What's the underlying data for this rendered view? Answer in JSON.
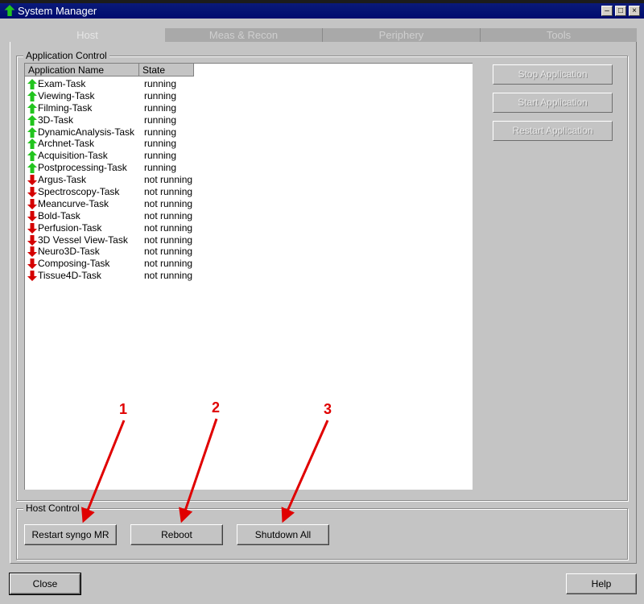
{
  "window": {
    "title": "System Manager"
  },
  "tabs": [
    "Host",
    "Meas & Recon",
    "Periphery",
    "Tools"
  ],
  "application_control": {
    "label": "Application Control",
    "columns": [
      "Application Name",
      "State"
    ],
    "rows": [
      {
        "name": "Exam-Task",
        "state": "running",
        "status": "up"
      },
      {
        "name": "Viewing-Task",
        "state": "running",
        "status": "up"
      },
      {
        "name": "Filming-Task",
        "state": "running",
        "status": "up"
      },
      {
        "name": "3D-Task",
        "state": "running",
        "status": "up"
      },
      {
        "name": "DynamicAnalysis-Task",
        "state": "running",
        "status": "up"
      },
      {
        "name": "Archnet-Task",
        "state": "running",
        "status": "up"
      },
      {
        "name": "Acquisition-Task",
        "state": "running",
        "status": "up"
      },
      {
        "name": "Postprocessing-Task",
        "state": "running",
        "status": "up"
      },
      {
        "name": "Argus-Task",
        "state": "not running",
        "status": "down"
      },
      {
        "name": "Spectroscopy-Task",
        "state": "not running",
        "status": "down"
      },
      {
        "name": "Meancurve-Task",
        "state": "not running",
        "status": "down"
      },
      {
        "name": "Bold-Task",
        "state": "not running",
        "status": "down"
      },
      {
        "name": "Perfusion-Task",
        "state": "not running",
        "status": "down"
      },
      {
        "name": "3D Vessel View-Task",
        "state": "not running",
        "status": "down"
      },
      {
        "name": "Neuro3D-Task",
        "state": "not running",
        "status": "down"
      },
      {
        "name": "Composing-Task",
        "state": "not running",
        "status": "down"
      },
      {
        "name": "Tissue4D-Task",
        "state": "not running",
        "status": "down"
      }
    ],
    "buttons": {
      "stop": "Stop Application",
      "start": "Start Application",
      "restart": "Restart Application"
    }
  },
  "host_control": {
    "label": "Host Control",
    "buttons": {
      "restart_syngo": "Restart syngo MR",
      "reboot": "Reboot",
      "shutdown": "Shutdown All"
    }
  },
  "footer": {
    "close": "Close",
    "help": "Help"
  },
  "annotations": [
    "1",
    "2",
    "3"
  ],
  "colors": {
    "up_arrow": "#22c41e",
    "down_arrow": "#d40000",
    "annotation": "#e00000",
    "title_bar": "#000c6e"
  },
  "icons": {
    "status_up": "green-up-arrow-icon",
    "status_down": "red-down-arrow-icon"
  }
}
